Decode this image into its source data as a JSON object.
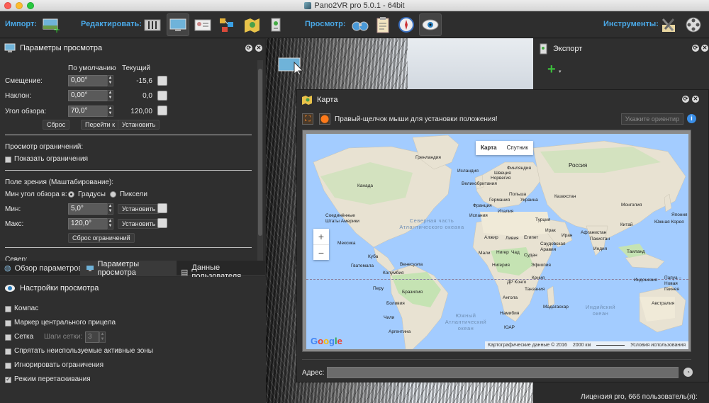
{
  "window": {
    "title": "Pano2VR pro 5.0.1 - 64bit"
  },
  "toolbar": {
    "import_label": "Импорт:",
    "edit_label": "Редактировать:",
    "view_label": "Просмотр:",
    "tools_label": "Инструменты:"
  },
  "view_params": {
    "title": "Параметры просмотра",
    "col_default": "По умолчанию",
    "col_current": "Текущий",
    "rows": [
      {
        "label": "Смещение:",
        "default": "0,00°",
        "current": "-15,6"
      },
      {
        "label": "Наклон:",
        "default": "0,00°",
        "current": "0,0"
      },
      {
        "label": "Угол обзора:",
        "default": "70,0°",
        "current": "120,00"
      }
    ],
    "reset_btn": "Сброс",
    "goto_btn": "Перейти к",
    "set_btn": "Установить",
    "limits_title": "Просмотр ограничений:",
    "show_limits": "Показать ограничения",
    "fov_title": "Поле зрения (Маштабирование):",
    "min_fov_label": "Мин угол обзора в:",
    "degrees": "Градусы",
    "pixels": "Пиксели",
    "min_label": "Мин:",
    "min_value": "5,0°",
    "max_label": "Макс:",
    "max_value": "120,0°",
    "set_btn2": "Установить",
    "set_btn3": "Установить",
    "reset_limits": "Сброс ограничений",
    "north_label": "Север:"
  },
  "tabs": [
    {
      "label": "Обзор параметров"
    },
    {
      "label": "Параметры просмотра"
    },
    {
      "label": "Данные пользователя"
    }
  ],
  "display_settings": {
    "title": "Настройки просмотра",
    "items": [
      {
        "label": "Компас",
        "checked": false
      },
      {
        "label": "Маркер центрального прицела",
        "checked": false
      },
      {
        "label": "Сетка",
        "checked": false
      },
      {
        "label": "Спрятать неиспользуемые активные зоны",
        "checked": false
      },
      {
        "label": "Игнорировать ограничения",
        "checked": false
      },
      {
        "label": "Режим перетаскивания",
        "checked": true
      }
    ],
    "grid_steps_label": "Шаги сетки:",
    "grid_steps_value": "3"
  },
  "export_panel": {
    "title": "Экспорт"
  },
  "map_dialog": {
    "title": "Карта",
    "hint": "Правый-щелчок мыши для установки положения!",
    "orient_btn": "Укажите ориентир",
    "map_tab": "Карта",
    "satellite_tab": "Спутник",
    "address_label": "Адрес:",
    "attribution": "Картографические данные © 2016",
    "scale": "2000 км",
    "terms": "Условия использования",
    "google": "Google",
    "oceans": {
      "north_atlantic": "Северная часть Атлантического океана",
      "south_atlantic": "Южный Атлантический океан",
      "indian": "Индийский океан"
    },
    "places": [
      "Гренландия",
      "Исландия",
      "Канада",
      "Швеция",
      "Финляндия",
      "Норвегия",
      "Великобритания",
      "Германия",
      "Польша",
      "Россия",
      "Казахстан",
      "Франция",
      "Италия",
      "Украина",
      "Испания",
      "Монголия",
      "Турция",
      "Соединённые Штаты Америки",
      "Ирак",
      "Иран",
      "Китай",
      "Южная Корея",
      "Япония",
      "Мексика",
      "Алжир",
      "Ливия",
      "Египет",
      "Саудовская Аравия",
      "Афганистан",
      "Пакистан",
      "Индия",
      "Куба",
      "Мали",
      "Нигер",
      "Чад",
      "Судан",
      "Таиланд",
      "Гватемала",
      "Венесуэла",
      "Нигерия",
      "Эфиопия",
      "Колумбия",
      "Кения",
      "Индонезия",
      "Перу",
      "Бразилия",
      "ДР Конго",
      "Танзания",
      "Ангола",
      "Боливия",
      "Намибия",
      "Мадагаскар",
      "Чили",
      "ЮАР",
      "Аргентина",
      "Папуа – Новая Гвинея",
      "Австралия"
    ]
  },
  "status": {
    "license": "Лицензия pro, 666 пользователь(я):"
  }
}
